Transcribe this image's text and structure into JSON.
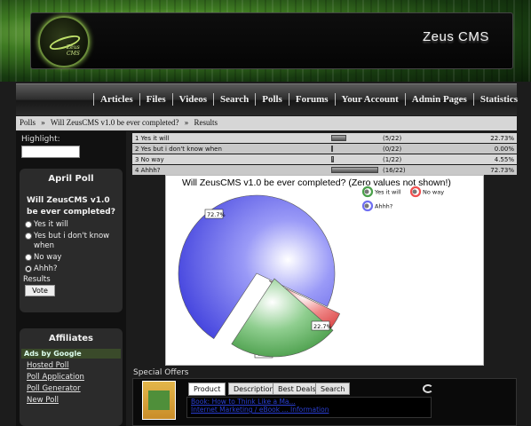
{
  "header": {
    "site_title": "Zeus  CMS",
    "logo_text": "Zeus CMS"
  },
  "nav": {
    "items": [
      "Articles",
      "Files",
      "Videos",
      "Search",
      "Polls",
      "Forums",
      "Your Account",
      "Admin Pages",
      "Statistics"
    ]
  },
  "breadcrumb": [
    "Polls",
    "»",
    "Will ZeusCMS v1.0 be ever completed?",
    "»",
    "Results"
  ],
  "sidebar": {
    "highlight_label": "Highlight:",
    "highlight_value": "",
    "poll": {
      "title": "April Poll",
      "question": "Will ZeusCMS v1.0 be ever completed?",
      "options": [
        {
          "label": "Yes it will",
          "selected": false
        },
        {
          "label": "Yes but i don't know when",
          "selected": false
        },
        {
          "label": "No way",
          "selected": false
        },
        {
          "label": "Ahhh?",
          "selected": true
        }
      ],
      "results_label": "Results",
      "vote_label": "Vote"
    },
    "affiliates": {
      "title": "Affiliates",
      "ads_label": "Ads by Google",
      "links": [
        "Hosted Poll",
        "Poll Application",
        "Poll Generator",
        "New Poll"
      ]
    }
  },
  "results": [
    {
      "label": "1 Yes it will",
      "count": "(5/22)",
      "pct": "22.73%",
      "fraction": 0.2273
    },
    {
      "label": "2 Yes but i don't know when",
      "count": "(0/22)",
      "pct": "0.00%",
      "fraction": 0.0
    },
    {
      "label": "3 No way",
      "count": "(1/22)",
      "pct": "4.55%",
      "fraction": 0.0455
    },
    {
      "label": "4 Ahhh?",
      "count": "(16/22)",
      "pct": "72.73%",
      "fraction": 0.7273
    }
  ],
  "chart_data": {
    "type": "pie",
    "title": "Will ZeusCMS v1.0 be ever completed? (Zero values not shown!)",
    "legend_placement": "top-right",
    "slices": [
      {
        "name": "Ahhh?",
        "value": 72.7,
        "label": "72.7%",
        "color": "#6f6ff2"
      },
      {
        "name": "No way",
        "value": 4.5,
        "label": "4.5%",
        "color": "#ef4f4f"
      },
      {
        "name": "Yes it will",
        "value": 22.7,
        "label": "22.7%",
        "color": "#4aa04a"
      }
    ],
    "legend": [
      {
        "name": "Yes it will",
        "color": "#4aa04a"
      },
      {
        "name": "No way",
        "color": "#ef4f4f"
      },
      {
        "name": "Ahhh?",
        "color": "#6f6ff2"
      }
    ]
  },
  "offers": {
    "title": "Special Offers",
    "tabs": [
      "Product",
      "Description",
      "Best Deals",
      "Search"
    ],
    "links": [
      "Book: How to Think Like a Ma...",
      "Internet Marketing  /  eBook ... Information"
    ]
  }
}
